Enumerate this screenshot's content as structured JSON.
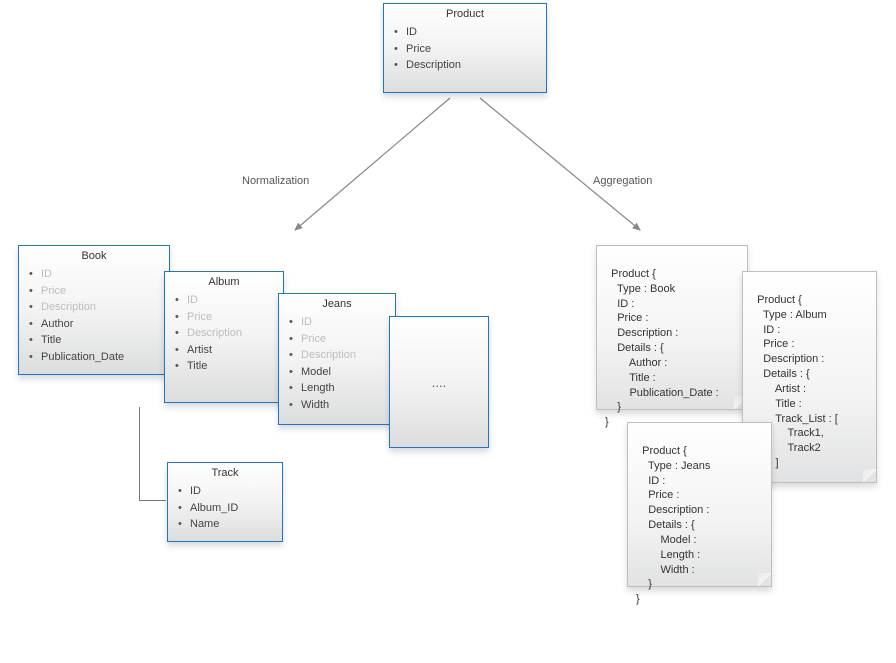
{
  "root": {
    "title": "Product",
    "attrs": [
      "ID",
      "Price",
      "Description"
    ]
  },
  "labels": {
    "normalization": "Normalization",
    "aggregation": "Aggregation"
  },
  "normalization": {
    "book": {
      "title": "Book",
      "inherited": [
        "ID",
        "Price",
        "Description"
      ],
      "own": [
        "Author",
        "Title",
        "Publication_Date"
      ]
    },
    "album": {
      "title": "Album",
      "inherited": [
        "ID",
        "Price",
        "Description"
      ],
      "own": [
        "Artist",
        "Title"
      ]
    },
    "jeans": {
      "title": "Jeans",
      "inherited": [
        "ID",
        "Price",
        "Description"
      ],
      "own": [
        "Model",
        "Length",
        "Width"
      ]
    },
    "more": "....",
    "track": {
      "title": "Track",
      "attrs": [
        "ID",
        "Album_ID",
        "Name"
      ]
    }
  },
  "aggregation": {
    "book": "Product {\n    Type : Book\n    ID :\n    Price :\n    Description :\n    Details : {\n        Author :\n        Title :\n        Publication_Date :\n    }\n}",
    "album": "Product {\n    Type : Album\n    ID :\n    Price :\n    Description :\n    Details : {\n        Artist :\n        Title :\n        Track_List : [\n            Track1,\n            Track2\n        ]\n    }\n}",
    "jeans": "Product {\n    Type : Jeans\n    ID :\n    Price :\n    Description :\n    Details : {\n        Model :\n        Length :\n        Width :\n    }\n}"
  }
}
